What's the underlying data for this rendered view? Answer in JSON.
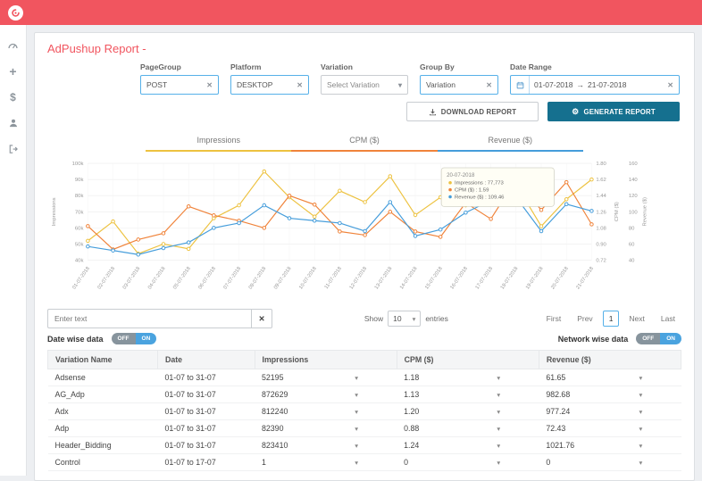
{
  "colors": {
    "brand": "#f1555f",
    "accent": "#56b0e8",
    "teal": "#15708f"
  },
  "icons": {
    "caret_down": "▾",
    "clear": "✕",
    "gear": "⚙"
  },
  "header": {
    "title": "AdPushup Report -"
  },
  "sidebar": {
    "items": [
      "dashboard",
      "add",
      "billing",
      "account",
      "logout"
    ]
  },
  "filters": {
    "pagegroup": {
      "label": "PageGroup",
      "value": "POST"
    },
    "platform": {
      "label": "Platform",
      "value": "DESKTOP"
    },
    "variation": {
      "label": "Variation",
      "value": "Select Variation"
    },
    "groupby": {
      "label": "Group By",
      "value": "Variation"
    },
    "daterange": {
      "label": "Date Range",
      "start": "01-07-2018",
      "arrow": "→",
      "end": "21-07-2018"
    }
  },
  "actions": {
    "download": "DOWNLOAD REPORT",
    "generate": "GENERATE REPORT"
  },
  "tabs": [
    {
      "label": "Impressions",
      "color": "#edc240"
    },
    {
      "label": "CPM ($)",
      "color": "#f0833a"
    },
    {
      "label": "Revenue ($)",
      "color": "#459ddb"
    }
  ],
  "chart_data": {
    "type": "line",
    "x": [
      "01-07-2018",
      "02-07-2018",
      "03-07-2018",
      "04-07-2018",
      "05-07-2018",
      "06-07-2018",
      "07-07-2018",
      "08-07-2018",
      "09-07-2018",
      "10-07-2018",
      "11-07-2018",
      "12-07-2018",
      "13-07-2018",
      "14-07-2018",
      "15-07-2018",
      "16-07-2018",
      "17-07-2018",
      "18-07-2018",
      "19-07-2018",
      "20-07-2018",
      "21-07-2018"
    ],
    "series": [
      {
        "name": "Impressions",
        "axis": "impressions",
        "color": "#edc240",
        "values": [
          52000,
          64000,
          44000,
          50000,
          47000,
          66000,
          74000,
          95000,
          79000,
          67000,
          83000,
          76000,
          92000,
          68000,
          79000,
          74000,
          96000,
          87000,
          61000,
          77773,
          90000
        ]
      },
      {
        "name": "CPM ($)",
        "axis": "cpm",
        "color": "#f0833a",
        "values": [
          1.1,
          0.84,
          0.95,
          1.02,
          1.32,
          1.22,
          1.16,
          1.08,
          1.44,
          1.34,
          1.04,
          1.0,
          1.26,
          1.04,
          0.98,
          1.36,
          1.18,
          1.62,
          1.28,
          1.59,
          1.12
        ]
      },
      {
        "name": "Revenue ($)",
        "axis": "revenue",
        "color": "#459ddb",
        "values": [
          57,
          52,
          47,
          55,
          62,
          80,
          86,
          108,
          92,
          89,
          86,
          76,
          112,
          70,
          78,
          99,
          114,
          118,
          76,
          109.46,
          101
        ]
      }
    ],
    "axes": {
      "impressions": {
        "label": "Impressions",
        "min": 40000,
        "max": 100000,
        "ticks": [
          "100k",
          "90k",
          "80k",
          "70k",
          "60k",
          "50k",
          "40k"
        ]
      },
      "cpm": {
        "label": "CPM ($)",
        "min": 0.72,
        "max": 1.8,
        "ticks": [
          "1.80",
          "1.62",
          "1.44",
          "1.26",
          "1.08",
          "0.90",
          "0.72"
        ]
      },
      "revenue": {
        "label": "Revenue ($)",
        "min": 40,
        "max": 160,
        "ticks": [
          "160",
          "140",
          "120",
          "100",
          "80",
          "60",
          "40"
        ]
      }
    },
    "grid": true,
    "legend_position": "none"
  },
  "tooltip": {
    "date": "20-07-2018",
    "items": [
      {
        "label": "Impressions",
        "value": "77,773",
        "color": "#edc240"
      },
      {
        "label": "CPM ($)",
        "value": "1.59",
        "color": "#f0833a"
      },
      {
        "label": "Revenue ($)",
        "value": "109.46",
        "color": "#459ddb"
      }
    ]
  },
  "table_controls": {
    "search_placeholder": "Enter text",
    "show_label": "Show",
    "entries_value": "10",
    "entries_label": "entries",
    "pagination": [
      "First",
      "Prev",
      "1",
      "Next",
      "Last"
    ],
    "active_page": "1"
  },
  "toggles": {
    "date_wise": {
      "label": "Date wise data",
      "off": "OFF",
      "on": "ON"
    },
    "network_wise": {
      "label": "Network wise data",
      "off": "OFF",
      "on": "ON"
    }
  },
  "table": {
    "columns": [
      "Variation Name",
      "Date",
      "Impressions",
      "CPM ($)",
      "Revenue ($)"
    ],
    "rows": [
      {
        "variation": "Adsense",
        "date": "01-07 to 31-07",
        "impressions": "52195",
        "cpm": "1.18",
        "revenue": "61.65"
      },
      {
        "variation": "AG_Adp",
        "date": "01-07 to 31-07",
        "impressions": "872629",
        "cpm": "1.13",
        "revenue": "982.68"
      },
      {
        "variation": "Adx",
        "date": "01-07 to 31-07",
        "impressions": "812240",
        "cpm": "1.20",
        "revenue": "977.24"
      },
      {
        "variation": "Adp",
        "date": "01-07 to 31-07",
        "impressions": "82390",
        "cpm": "0.88",
        "revenue": "72.43"
      },
      {
        "variation": "Header_Bidding",
        "date": "01-07 to 31-07",
        "impressions": "823410",
        "cpm": "1.24",
        "revenue": "1021.76"
      },
      {
        "variation": "Control",
        "date": "01-07 to 17-07",
        "impressions": "1",
        "cpm": "0",
        "revenue": "0"
      }
    ]
  }
}
